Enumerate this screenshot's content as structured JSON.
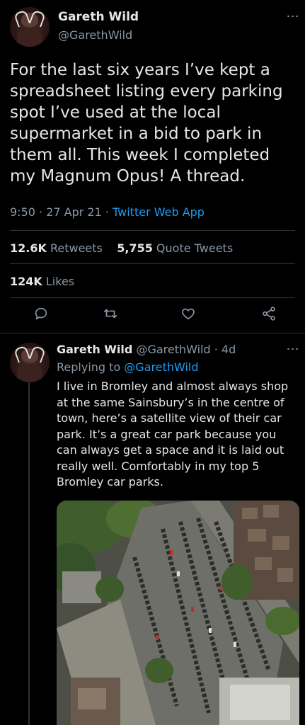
{
  "main_tweet": {
    "display_name": "Gareth Wild",
    "handle": "@GarethWild",
    "text": "For the last six years I’ve kept a spreadsheet listing every parking spot I’ve used at the local supermarket in a bid to park in them all. This week I completed my Magnum Opus! A thread.",
    "time": "9:50 · 27 Apr 21 · ",
    "source": "Twitter Web App",
    "retweets_count": "12.6K",
    "retweets_label": "Retweets",
    "quote_count": "5,755",
    "quote_label": "Quote Tweets",
    "likes_count": "124K",
    "likes_label": "Likes"
  },
  "reply_tweet": {
    "display_name": "Gareth Wild",
    "handle_time": "@GarethWild · 4d",
    "replying_prefix": "Replying to ",
    "replying_handle": "@GarethWild",
    "text": "I live in Bromley and almost always shop at the same Sainsbury’s in the centre of town, here’s a satellite view of their car park. It’s a great car park because you can always get a space and it is laid out really well. Comfortably in my top 5 Bromley car parks."
  },
  "icons": [
    "more-icon",
    "reply-icon",
    "retweet-icon",
    "like-icon",
    "share-icon"
  ],
  "colors": {
    "background": "#000000",
    "text": "#e6e6e6",
    "secondary": "#8b98a5",
    "accent": "#1d9bf0",
    "divider": "#2f3336"
  }
}
